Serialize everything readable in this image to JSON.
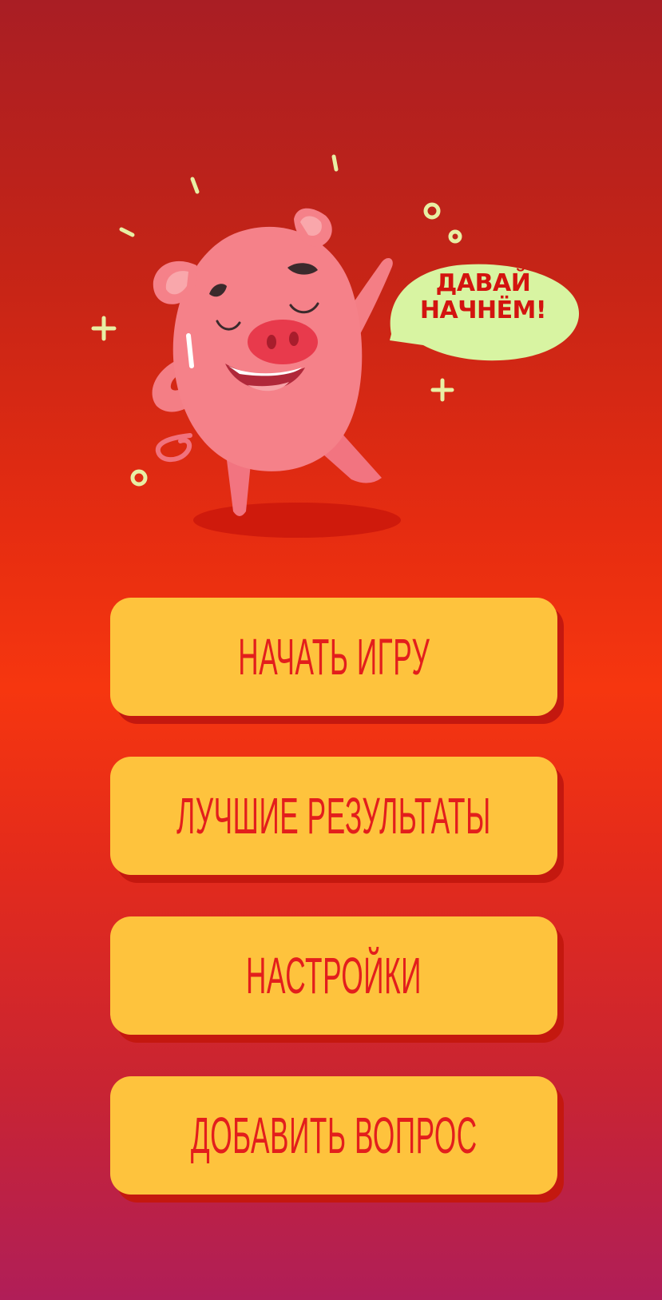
{
  "mascot": {
    "speech_line1": "ДАВАЙ",
    "speech_line2": "НАЧНЁМ!"
  },
  "menu": {
    "start_game": "НАЧАТЬ ИГРУ",
    "best_results": "ЛУЧШИЕ РЕЗУЛЬТАТЫ",
    "settings": "НАСТРОЙКИ",
    "add_question": "ДОБАВИТЬ ВОПРОС"
  },
  "colors": {
    "button_fill": "#fec33d",
    "button_text": "#e31e1c",
    "button_shadow": "#c4180f",
    "bubble_fill": "#d8f4a2",
    "pig_pink": "#f27f86"
  }
}
